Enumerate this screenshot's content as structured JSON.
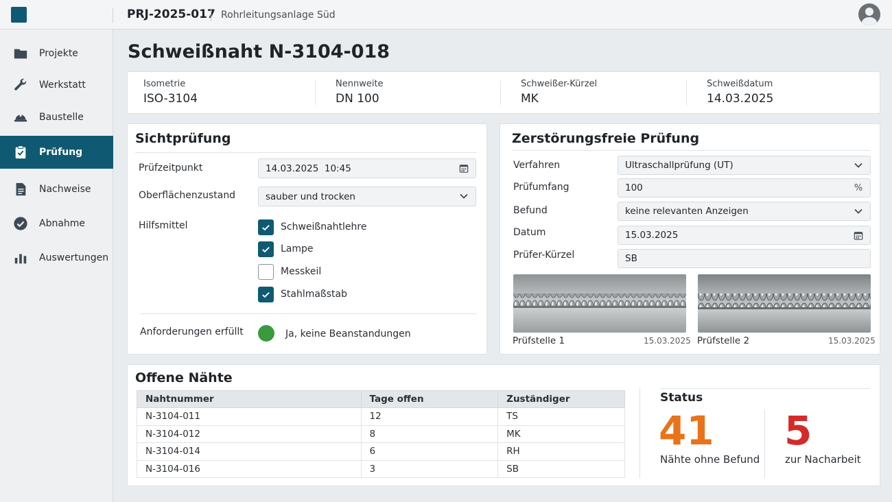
{
  "header": {
    "project_id": "PRJ-2025-017",
    "project_name": "Rohrleitungsanlage Süd"
  },
  "sidebar": {
    "items": [
      {
        "label": "Projekte",
        "icon": "folder-icon"
      },
      {
        "label": "Werkstatt",
        "icon": "wrench-icon"
      },
      {
        "label": "Baustelle",
        "icon": "hard-hat-icon"
      },
      {
        "label": "Prüfung",
        "icon": "clipboard-check-icon",
        "active": true
      },
      {
        "label": "Nachweise",
        "icon": "document-icon"
      },
      {
        "label": "Abnahme",
        "icon": "check-circle-icon"
      },
      {
        "label": "Auswertungen",
        "icon": "bar-chart-icon"
      }
    ]
  },
  "page": {
    "title": "Schweißnaht N-3104-018"
  },
  "info": {
    "isometrie_label": "Isometrie",
    "isometrie_value": "ISO-3104",
    "nennweite_label": "Nennweite",
    "nennweite_value": "DN 100",
    "kuerzel_label": "Schweißer-Kürzel",
    "kuerzel_value": "MK",
    "datum_label": "Schweißdatum",
    "datum_value": "14.03.2025"
  },
  "visual": {
    "title": "Sichtprüfung",
    "pruefzeitpunkt_label": "Prüfzeitpunkt",
    "pruefzeitpunkt_value": "14.03.2025  10:45",
    "oberflaeche_label": "Oberflächenzustand",
    "oberflaeche_value": "sauber und trocken",
    "hilfsmittel_label": "Hilfsmittel",
    "hilfsmittel": [
      {
        "label": "Schweißnahtlehre",
        "checked": true
      },
      {
        "label": "Lampe",
        "checked": true
      },
      {
        "label": "Messkeil",
        "checked": false
      },
      {
        "label": "Stahlmaßstab",
        "checked": true
      }
    ],
    "anforderungen_label": "Anforderungen erfüllt",
    "anforderungen_value": "Ja, keine Beanstandungen",
    "status_color": "#3a9a3e"
  },
  "ndt": {
    "title": "Zerstörungsfreie Prüfung",
    "verfahren_label": "Verfahren",
    "verfahren_value": "Ultraschallprüfung (UT)",
    "umfang_label": "Prüfumfang",
    "umfang_value": "100",
    "umfang_unit": "%",
    "befund_label": "Befund",
    "befund_value": "keine relevanten Anzeigen",
    "datum_label": "Datum",
    "datum_value": "15.03.2025",
    "pruefer_label": "Prüfer-Kürzel",
    "pruefer_value": "SB",
    "photos": [
      {
        "caption": "Prüfstelle 1",
        "date": "15.03.2025"
      },
      {
        "caption": "Prüfstelle 2",
        "date": "15.03.2025"
      }
    ]
  },
  "open": {
    "title": "Offene Nähte",
    "columns": [
      "Nahtnummer",
      "Tage offen",
      "Zuständiger"
    ],
    "rows": [
      [
        "N-3104-011",
        "12",
        "TS"
      ],
      [
        "N-3104-012",
        "8",
        "MK"
      ],
      [
        "N-3104-014",
        "6",
        "RH"
      ],
      [
        "N-3104-016",
        "3",
        "SB"
      ]
    ]
  },
  "status": {
    "title": "Status",
    "ok_count": "41",
    "ok_label": "Nähte ohne Befund",
    "ok_color": "#e8731a",
    "rework_count": "5",
    "rework_label": "zur Nacharbeit",
    "rework_color": "#d42a2a"
  }
}
